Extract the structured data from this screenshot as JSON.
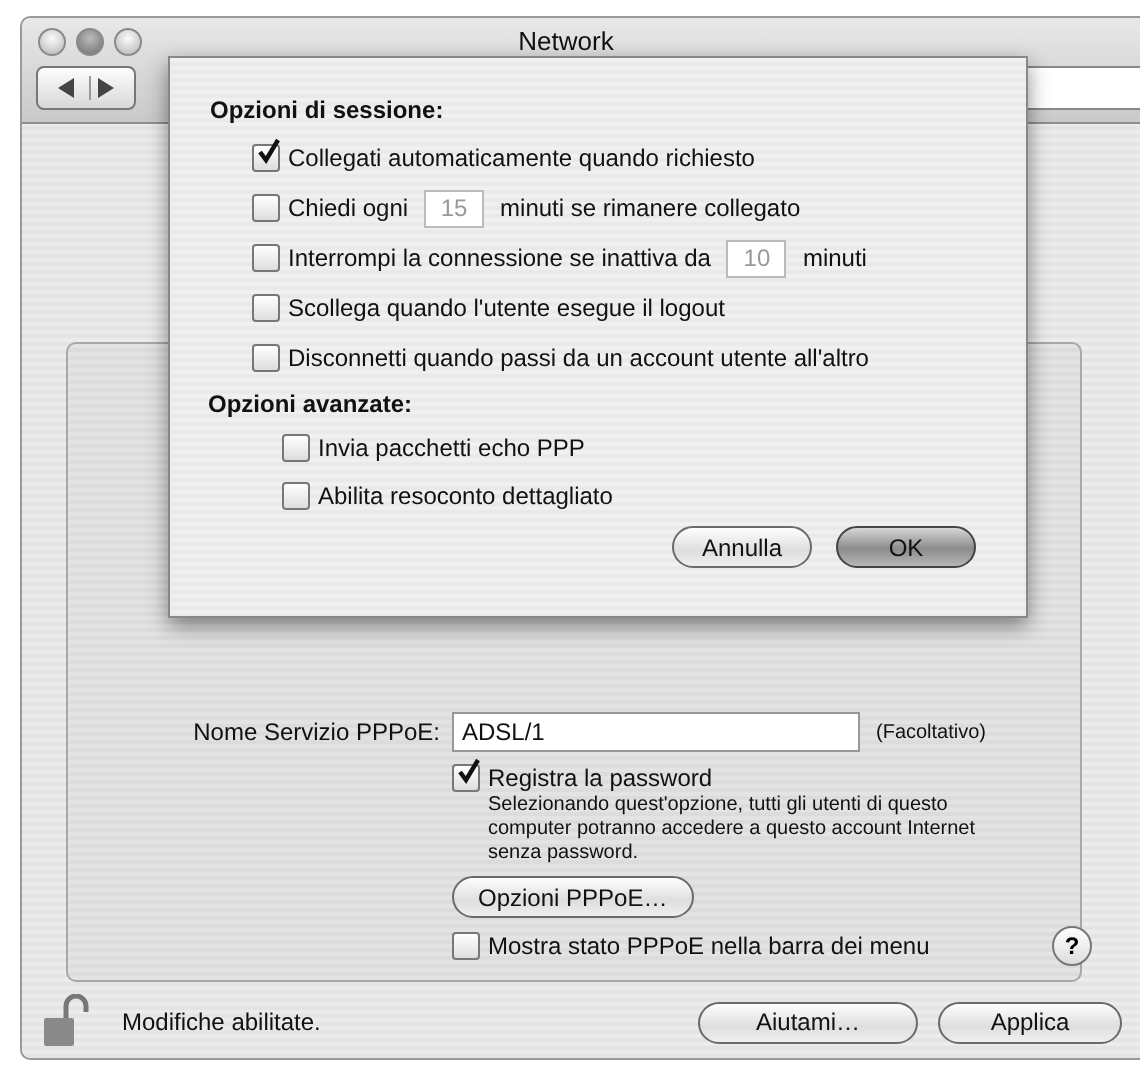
{
  "window": {
    "title": "Network"
  },
  "session_options": {
    "heading": "Opzioni di sessione:",
    "items": [
      {
        "kind": "plain",
        "checked": true,
        "label": "Collegati automaticamente quando richiesto"
      },
      {
        "kind": "field",
        "checked": false,
        "disabled": true,
        "before": "Chiedi ogni",
        "value": "15",
        "after": "minuti se rimanere collegato"
      },
      {
        "kind": "field",
        "checked": false,
        "disabled": true,
        "before": "Interrompi la connessione se inattiva da",
        "value": "10",
        "after": "minuti"
      },
      {
        "kind": "plain",
        "checked": false,
        "label": "Scollega quando l'utente esegue il logout"
      },
      {
        "kind": "plain",
        "checked": false,
        "label": "Disconnetti quando passi da un account utente all'altro"
      }
    ]
  },
  "advanced_options": {
    "heading": "Opzioni avanzate:",
    "items": [
      {
        "checked": false,
        "label": "Invia pacchetti echo PPP"
      },
      {
        "checked": false,
        "label": "Abilita resoconto dettagliato"
      }
    ]
  },
  "sheet_buttons": [
    {
      "label": "Annulla",
      "default": false
    },
    {
      "label": "OK",
      "default": true
    }
  ],
  "service": {
    "label": "Nome Servizio PPPoE:",
    "value": "ADSL/1",
    "note": "(Facoltativo)"
  },
  "save_password": {
    "label": "Registra la password",
    "checked": true,
    "description": "Selezionando quest'opzione, tutti gli utenti di questo computer potranno accedere a questo account Internet senza password."
  },
  "pppoe_options_button": "Opzioni PPPoE…",
  "menu_status": {
    "label": "Mostra stato PPPoE nella barra dei menu",
    "checked": false
  },
  "help": "?",
  "status": "Modifiche abilitate.",
  "buttons": [
    "Aiutami…",
    "Applica"
  ]
}
